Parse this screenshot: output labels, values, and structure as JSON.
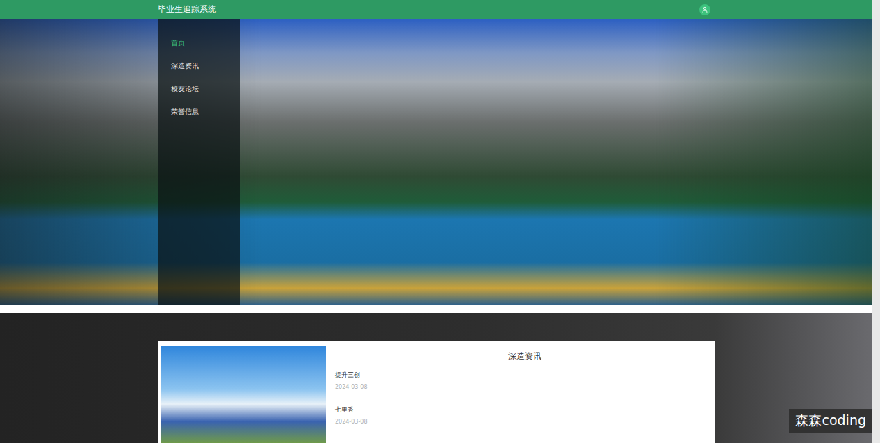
{
  "header": {
    "title": "毕业生追踪系统"
  },
  "sidebar": {
    "items": [
      {
        "label": "首页",
        "selected": true
      },
      {
        "label": "深造资讯",
        "selected": false
      },
      {
        "label": "校友论坛",
        "selected": false
      },
      {
        "label": "荣誉信息",
        "selected": false
      }
    ]
  },
  "news": {
    "title": "深造资讯",
    "items": [
      {
        "title": "提升三创",
        "date": "2024-03-08"
      },
      {
        "title": "七里香",
        "date": "2024-03-08"
      }
    ]
  },
  "watermark": "森森coding"
}
